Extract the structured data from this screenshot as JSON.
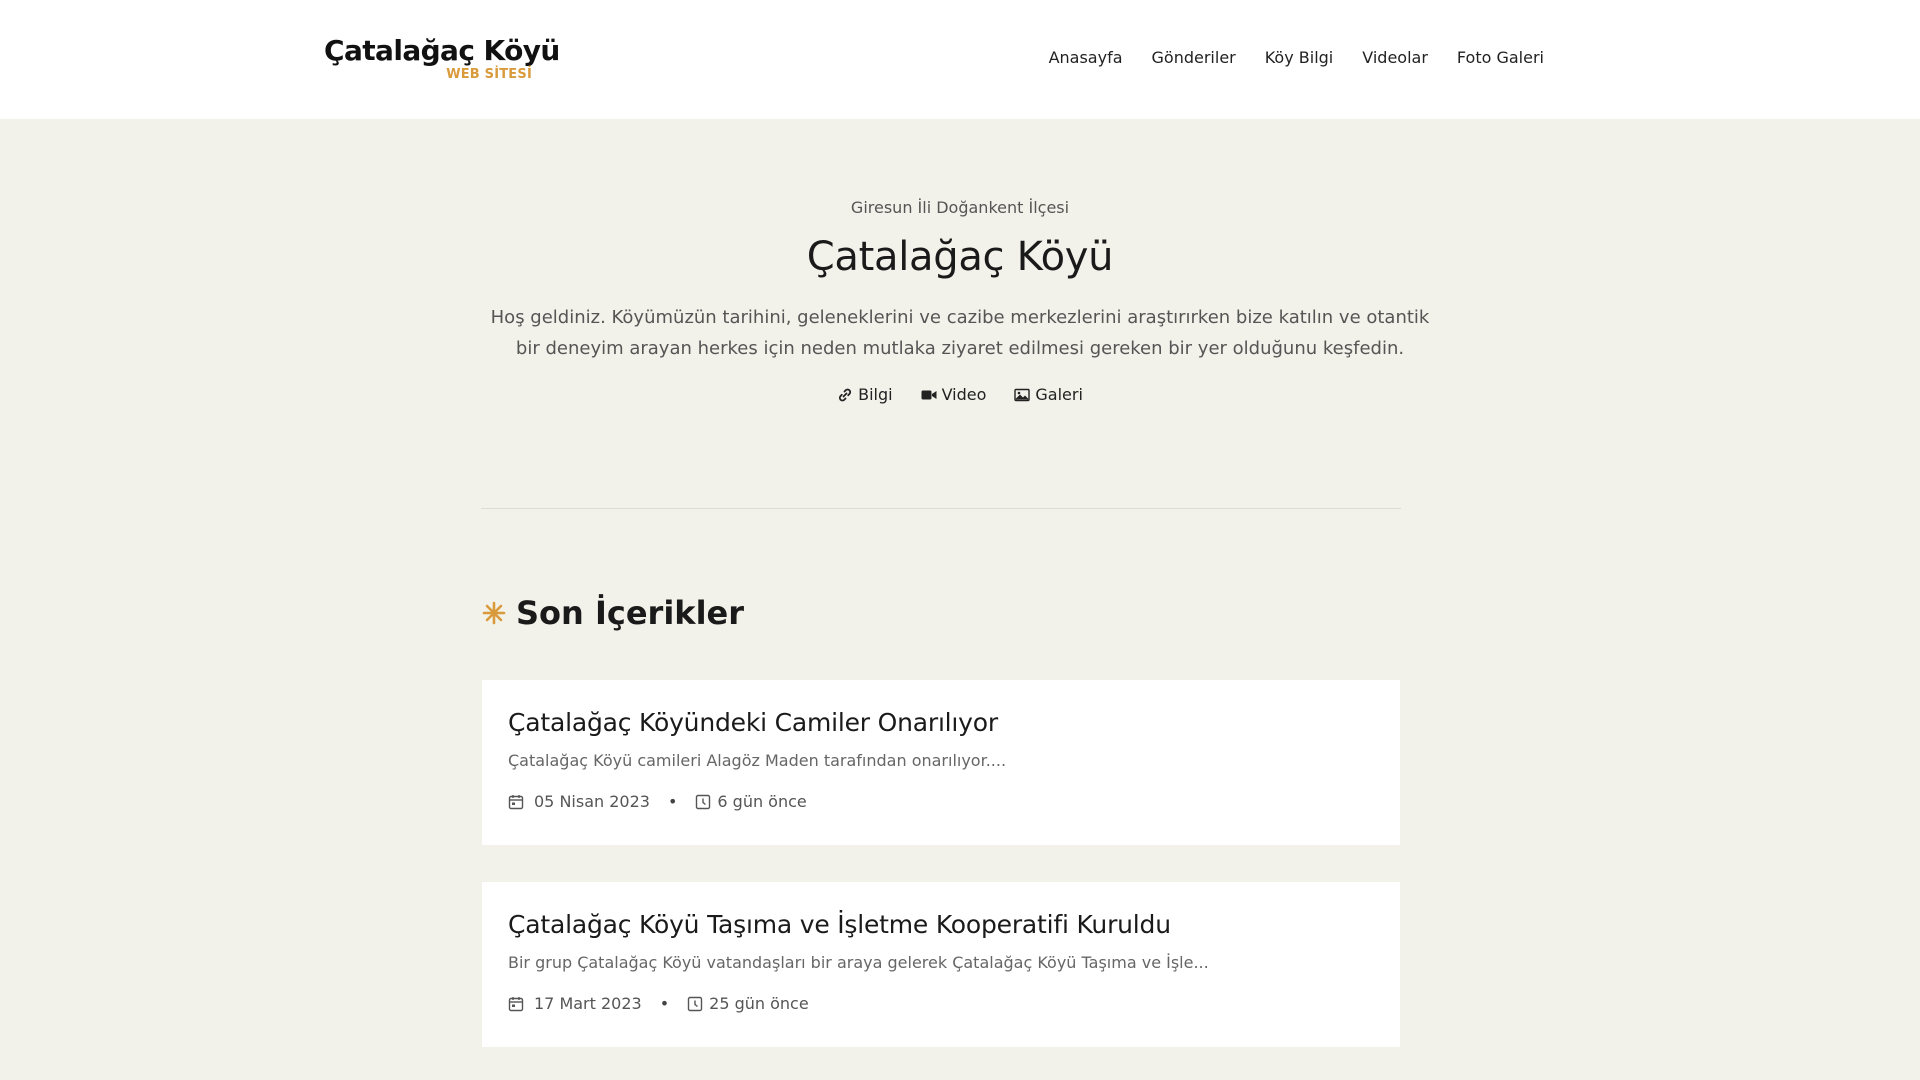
{
  "logo": {
    "title": "Çatalağaç Köyü",
    "subtitle": "WEB SİTESİ"
  },
  "nav": {
    "items": [
      {
        "label": "Anasayfa"
      },
      {
        "label": "Gönderiler"
      },
      {
        "label": "Köy Bilgi"
      },
      {
        "label": "Videolar"
      },
      {
        "label": "Foto Galeri"
      }
    ]
  },
  "hero": {
    "subtitle": "Giresun İli Doğankent İlçesi",
    "title": "Çatalağaç Köyü",
    "description": "Hoş geldiniz. Köyümüzün tarihini, geleneklerini ve cazibe merkezlerini araştırırken bize katılın ve otantik bir deneyim arayan herkes için neden mutlaka ziyaret edilmesi gereken bir yer olduğunu keşfedin.",
    "links": [
      {
        "label": "Bilgi",
        "icon": "link-icon"
      },
      {
        "label": "Video",
        "icon": "video-camera-icon"
      },
      {
        "label": "Galeri",
        "icon": "image-icon"
      }
    ]
  },
  "section": {
    "title": "Son İçerikler",
    "icon": "asterisk-icon"
  },
  "posts": [
    {
      "title": "Çatalağaç Köyündeki Camiler Onarılıyor",
      "excerpt": "Çatalağaç Köyü camileri Alagöz Maden tarafından onarılıyor....",
      "date": "05 Nisan 2023",
      "ago": "6 gün önce"
    },
    {
      "title": "Çatalağaç Köyü Taşıma ve İşletme Kooperatifi Kuruldu",
      "excerpt": "Bir grup Çatalağaç Köyü vatandaşları bir araya gelerek Çatalağaç Köyü Taşıma ve İşle...",
      "date": "17 Mart 2023",
      "ago": "25 gün önce"
    }
  ],
  "colors": {
    "accent": "#d99a3c",
    "background": "#f2f2ea",
    "card": "#ffffff"
  }
}
